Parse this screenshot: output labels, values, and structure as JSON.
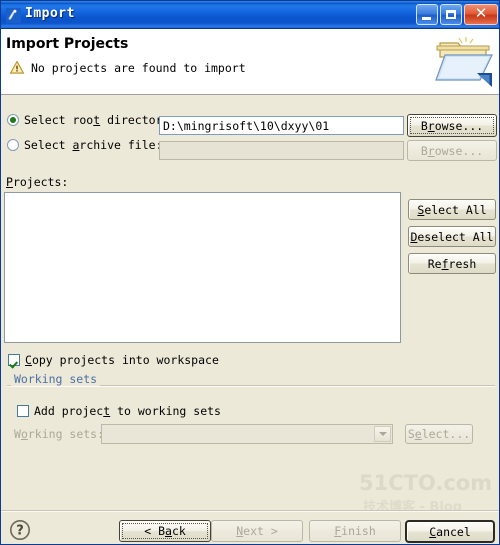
{
  "window": {
    "title": "Import",
    "icon": "import-wizard-icon",
    "controls": {
      "minimize": "minimize-icon",
      "maximize": "maximize-icon",
      "close": "close-icon"
    }
  },
  "header": {
    "title": "Import Projects",
    "message": "No projects are found to import",
    "message_icon": "warning-triangle-icon",
    "banner_icon": "open-folder-icon"
  },
  "source": {
    "root_directory": {
      "label": "Select root directory:",
      "label_pre": "Select roo",
      "label_mnemonic": "t",
      "label_post": " directory:",
      "selected": true,
      "value": "D:\\mingrisoft\\10\\dxyy\\01",
      "browse_label": "Browse...",
      "browse_pre": "B",
      "browse_mnemonic": "r",
      "browse_post": "owse..."
    },
    "archive_file": {
      "label": "Select archive file:",
      "label_pre": "Select ",
      "label_mnemonic": "a",
      "label_post": "rchive file:",
      "selected": false,
      "value": "",
      "browse_label": "Browse...",
      "browse_pre": "B",
      "browse_mnemonic": "r",
      "browse_post": "owse...",
      "disabled": true
    }
  },
  "projects": {
    "label": "Projects:",
    "label_pre": "",
    "label_mnemonic": "P",
    "label_post": "rojects:",
    "items": [],
    "buttons": {
      "select_all_pre": "",
      "select_all_mnemonic": "S",
      "select_all_post": "elect All",
      "deselect_all_pre": "",
      "deselect_all_mnemonic": "D",
      "deselect_all_post": "eselect All",
      "refresh_pre": "Re",
      "refresh_mnemonic": "f",
      "refresh_post": "resh"
    }
  },
  "options": {
    "copy_projects": {
      "label_pre": "",
      "label_mnemonic": "C",
      "label_post": "opy projects into workspace",
      "checked": true
    }
  },
  "working_sets": {
    "group_label": "Working sets",
    "add_project": {
      "label_pre": "Add projec",
      "label_mnemonic": "t",
      "label_post": " to working sets",
      "checked": false
    },
    "field_label_pre": "W",
    "field_label_mnemonic": "o",
    "field_label_post": "rking sets:",
    "field_value": "",
    "select_label": "Select...",
    "select_pre": "S",
    "select_mnemonic": "e",
    "select_post": "lect...",
    "disabled": true
  },
  "footer": {
    "help_icon": "help-question-icon",
    "back": {
      "prefix": "< ",
      "pre": "B",
      "mnemonic": "a",
      "post": "ck",
      "enabled": true
    },
    "next": {
      "pre": "",
      "mnemonic": "N",
      "post": "ext >",
      "enabled": false
    },
    "finish": {
      "pre": "",
      "mnemonic": "F",
      "post": "inish",
      "enabled": false
    },
    "cancel": {
      "pre": "",
      "mnemonic": "C",
      "post": "ancel",
      "enabled": true
    }
  },
  "watermark": {
    "primary": "51CTO.com",
    "secondary": "技术博客 - Blog"
  },
  "colors": {
    "dialog_background": "#ece9d8",
    "titlebar_blue": "#0f5fd4",
    "close_red": "#c5381a",
    "group_label_blue": "#4a6fa5",
    "field_white": "#ffffff",
    "disabled_text": "#aba899"
  }
}
